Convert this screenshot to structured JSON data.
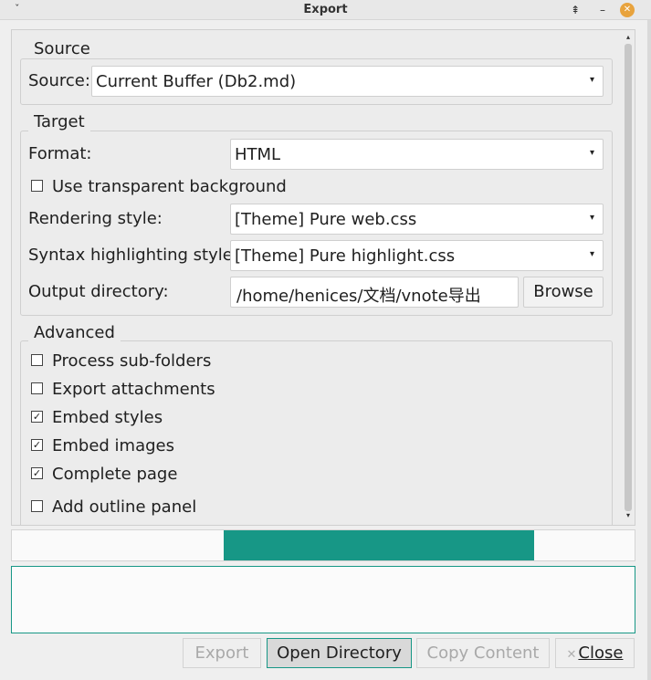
{
  "window": {
    "title": "Export",
    "menu_glyph": "ˇ",
    "pin_glyph": "⇞",
    "minimize_glyph": "–",
    "close_glyph": "✕"
  },
  "source_group": {
    "title": "Source",
    "source_label": "Source:",
    "source_value": "Current Buffer (Db2.md)"
  },
  "target_group": {
    "title": "Target",
    "format_label": "Format:",
    "format_value": "HTML",
    "transparent_label": "Use transparent background",
    "transparent_checked": false,
    "rendering_label": "Rendering style:",
    "rendering_value": "[Theme] Pure web.css",
    "syntax_label": "Syntax highlighting style:",
    "syntax_value": "[Theme] Pure highlight.css",
    "output_label": "Output directory:",
    "output_value": "/home/henices/文档/vnote导出",
    "browse_label": "Browse"
  },
  "advanced_group": {
    "title": "Advanced",
    "options": [
      {
        "label": "Process sub-folders",
        "checked": false
      },
      {
        "label": "Export attachments",
        "checked": false
      },
      {
        "label": "Embed styles",
        "checked": true
      },
      {
        "label": "Embed images",
        "checked": true
      },
      {
        "label": "Complete page",
        "checked": true
      },
      {
        "label": "Add outline panel",
        "checked": false
      }
    ]
  },
  "progress": {
    "color": "#179786"
  },
  "buttons": {
    "export": "Export",
    "open_directory": "Open Directory",
    "copy_content": "Copy Content",
    "close": "Close"
  },
  "glyphs": {
    "dropdown_arrow": "▾",
    "checked": "✓",
    "scroll_up": "▴",
    "scroll_down": "▾"
  }
}
